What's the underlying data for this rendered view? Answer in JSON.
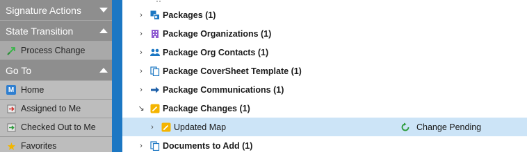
{
  "sidebar": {
    "sections": [
      {
        "title": "Signature Actions",
        "expanded": false
      },
      {
        "title": "State Transition",
        "expanded": true
      },
      {
        "title": "Go To",
        "expanded": true
      }
    ],
    "state_items": [
      {
        "label": "Process Change",
        "icon": "process-change-icon"
      }
    ],
    "goto_items": [
      {
        "label": "Home",
        "icon": "home-icon"
      },
      {
        "label": "Assigned to Me",
        "icon": "assigned-icon"
      },
      {
        "label": "Checked Out to Me",
        "icon": "checked-out-icon"
      },
      {
        "label": "Favorites",
        "icon": "favorites-icon"
      }
    ]
  },
  "tree": {
    "rows": [
      {
        "label": "Packages (1)",
        "icon": "package-icon"
      },
      {
        "label": "Package Organizations (1)",
        "icon": "organization-icon"
      },
      {
        "label": "Package Org Contacts (1)",
        "icon": "contacts-icon"
      },
      {
        "label": "Package CoverSheet Template (1)",
        "icon": "template-icon"
      },
      {
        "label": "Package Communications (1)",
        "icon": "arrow-right-icon"
      },
      {
        "label": "Package Changes (1)",
        "icon": "change-icon"
      },
      {
        "label": "Updated Map",
        "icon": "change-icon",
        "state": "Change Pending",
        "state_icon": "pending-icon"
      },
      {
        "label": "Documents to Add (1)",
        "icon": "documents-icon"
      }
    ]
  },
  "colors": {
    "sidebar_bg": "#b4b4b4",
    "section_header": "#8e8e8e",
    "accent_blue": "#1c77c3",
    "selected_row": "#cce4f7"
  }
}
